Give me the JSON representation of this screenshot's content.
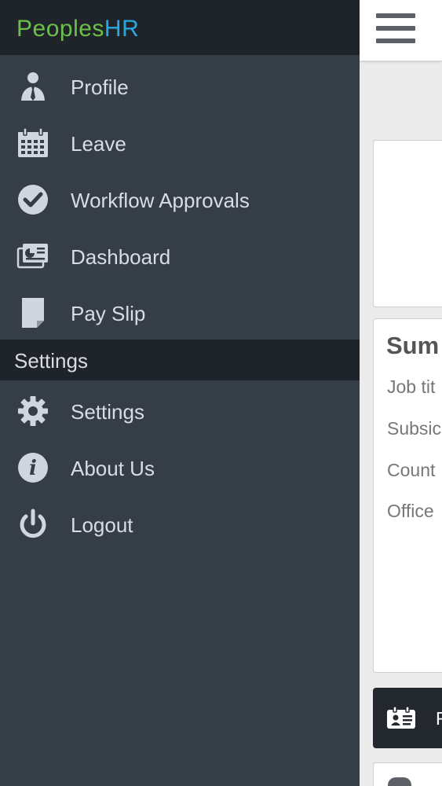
{
  "app": {
    "brand_part1": "Peoples",
    "brand_part2": "HR"
  },
  "colors": {
    "drawer_bg": "#353d47",
    "header_bg": "#1f232a",
    "brand_green": "#6cc04a",
    "brand_blue": "#2aa9e0",
    "icon": "#cfd6de"
  },
  "menu": {
    "items": [
      {
        "label": "Profile",
        "icon": "person-tie-icon"
      },
      {
        "label": "Leave",
        "icon": "calendar-icon"
      },
      {
        "label": "Workflow Approvals",
        "icon": "check-circle-icon"
      },
      {
        "label": "Dashboard",
        "icon": "dashboard-card-icon"
      },
      {
        "label": "Pay Slip",
        "icon": "document-icon"
      }
    ],
    "settings_section": {
      "title": "Settings",
      "items": [
        {
          "label": "Settings",
          "icon": "gear-icon"
        },
        {
          "label": "About Us",
          "icon": "info-icon"
        },
        {
          "label": "Logout",
          "icon": "power-icon"
        }
      ]
    }
  },
  "main": {
    "summary": {
      "title": "Sum",
      "fields": [
        "Job tit",
        "Subsic",
        "Count",
        "Office"
      ]
    },
    "profile_card": {
      "label": "F",
      "icon": "id-card-icon"
    }
  }
}
